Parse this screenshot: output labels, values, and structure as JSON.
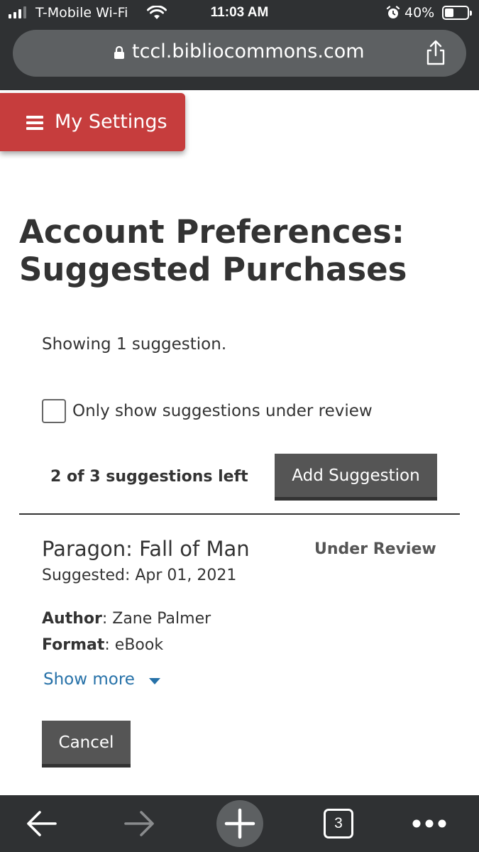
{
  "status_bar": {
    "carrier": "T-Mobile Wi-Fi",
    "time": "11:03 AM",
    "battery_percent": "40%",
    "battery_level": 0.4
  },
  "browser": {
    "url": "tccl.bibliocommons.com",
    "tab_count": "3"
  },
  "page": {
    "settings_button_label": "My Settings",
    "title": "Account Preferences: Suggested Purchases",
    "showing_text": "Showing 1 suggestion.",
    "filter_label": "Only show suggestions under review",
    "filter_checked": false,
    "suggestions_left": "2 of 3 suggestions left",
    "add_button_label": "Add Suggestion"
  },
  "suggestion": {
    "title": "Paragon: Fall of Man",
    "status": "Under Review",
    "suggested": "Suggested: Apr 01, 2021",
    "author_label": "Author",
    "author": "Zane Palmer",
    "format_label": "Format",
    "format": "eBook",
    "show_more": "Show more",
    "cancel_label": "Cancel"
  },
  "colors": {
    "chrome": "#2f3133",
    "url_bar": "#5d6062",
    "accent_red": "#c63d3d",
    "button_dark": "#555555",
    "link_blue": "#2671a8"
  },
  "icons": [
    "signal-icon",
    "wifi-icon",
    "alarm-icon",
    "battery-icon",
    "lock-icon",
    "share-icon",
    "hamburger-icon",
    "chevron-down-icon",
    "back-arrow-icon",
    "forward-arrow-icon",
    "new-tab-icon",
    "tabs-icon",
    "more-icon"
  ]
}
